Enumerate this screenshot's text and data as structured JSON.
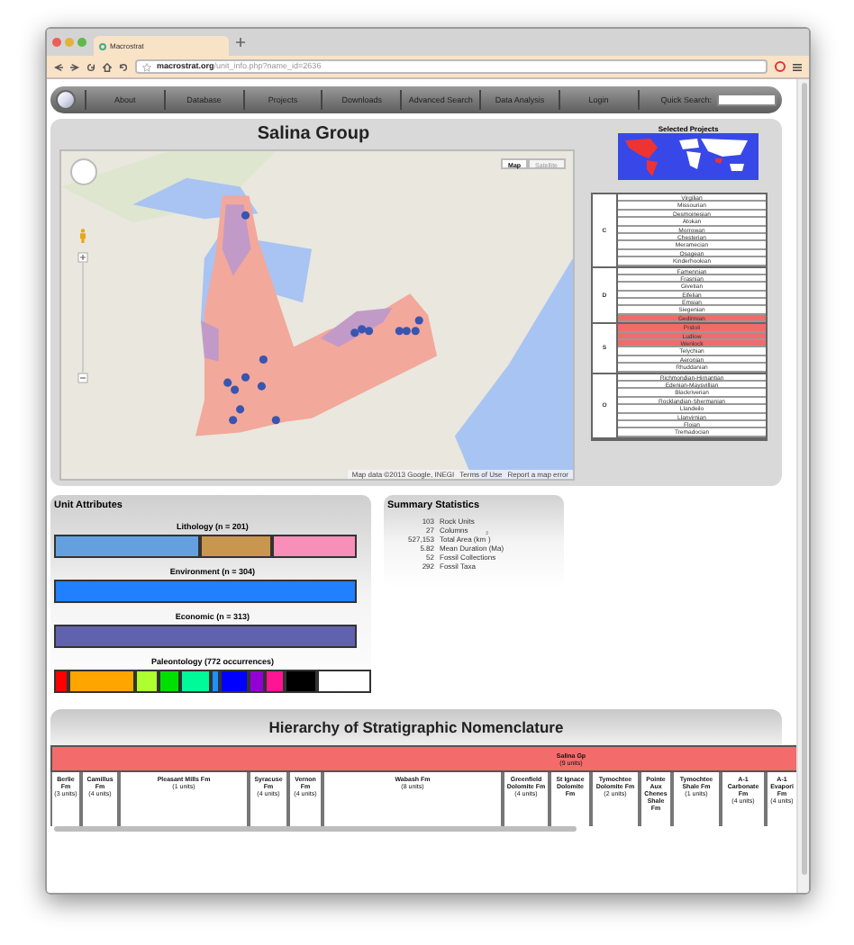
{
  "browser": {
    "tab_title": "Macrostrat",
    "url_host": "macrostrat.org",
    "url_path": "/unit_info.php?name_id=2636"
  },
  "nav": {
    "items": [
      "About",
      "Database",
      "Projects",
      "Downloads",
      "Advanced Search",
      "Data Analysis",
      "Login"
    ],
    "quick_search_label": "Quick Search:"
  },
  "title": "Salina Group",
  "map": {
    "type_buttons": [
      {
        "label": "Map",
        "selected": true
      },
      {
        "label": "Satellite",
        "selected": false
      }
    ],
    "attribution": [
      "Map data ©2013 Google, INEGI",
      "Terms of Use",
      "Report a map error"
    ]
  },
  "selected_projects_label": "Selected Projects",
  "timescale": [
    {
      "period": "C",
      "stages": [
        {
          "name": "Virgilian",
          "selected": false
        },
        {
          "name": "Missourian",
          "selected": false
        },
        {
          "name": "Desmoinesian",
          "selected": false
        },
        {
          "name": "Atokan",
          "selected": false
        },
        {
          "name": "Morrowan",
          "selected": false
        },
        {
          "name": "Chesterian",
          "selected": false
        },
        {
          "name": "Meramecian",
          "selected": false
        },
        {
          "name": "Osagean",
          "selected": false
        },
        {
          "name": "Kinderhookian",
          "selected": false
        }
      ]
    },
    {
      "period": "D",
      "stages": [
        {
          "name": "Famennian",
          "selected": false
        },
        {
          "name": "Frasnian",
          "selected": false
        },
        {
          "name": "Givetian",
          "selected": false
        },
        {
          "name": "Eifelian",
          "selected": false
        },
        {
          "name": "Emsian",
          "selected": false
        },
        {
          "name": "Siegenian",
          "selected": false
        },
        {
          "name": "Gedinnian",
          "selected": true
        }
      ]
    },
    {
      "period": "S",
      "stages": [
        {
          "name": "Pridoli",
          "selected": true
        },
        {
          "name": "Ludlow",
          "selected": true
        },
        {
          "name": "Wenlock",
          "selected": true
        },
        {
          "name": "Telychian",
          "selected": false
        },
        {
          "name": "Aeronian",
          "selected": false
        },
        {
          "name": "Rhuddanian",
          "selected": false
        }
      ]
    },
    {
      "period": "O",
      "stages": [
        {
          "name": "Richmondian-Hirnantian",
          "selected": false
        },
        {
          "name": "Edenian-Maysvillian",
          "selected": false
        },
        {
          "name": "Blackriverian",
          "selected": false
        },
        {
          "name": "Rocklandian-Shermanian",
          "selected": false
        },
        {
          "name": "Llandeilo",
          "selected": false
        },
        {
          "name": "Llanvirnian",
          "selected": false
        },
        {
          "name": "Floian",
          "selected": false
        },
        {
          "name": "Tremadocian",
          "selected": false
        }
      ]
    }
  ],
  "unit_attributes": {
    "title": "Unit Attributes",
    "bars": [
      {
        "label": "Lithology (n = 201)",
        "segments": [
          {
            "color": "#64a0e0"
          },
          {
            "color": "#c8964f"
          },
          {
            "color": "#f78fb8"
          }
        ]
      },
      {
        "label": "Environment (n = 304)",
        "segments": [
          {
            "color": "#2080ff"
          }
        ]
      },
      {
        "label": "Economic (n = 313)",
        "segments": [
          {
            "color": "#6062ad"
          }
        ]
      },
      {
        "label": "Paleontology (772 occurrences)",
        "segments": [
          {
            "color": "#ff0000"
          },
          {
            "color": "#ffa500"
          },
          {
            "color": "#adff2f"
          },
          {
            "color": "#00e000"
          },
          {
            "color": "#00fa9a"
          },
          {
            "color": "#1e90ff"
          },
          {
            "color": "#0000ff"
          },
          {
            "color": "#9400d3"
          },
          {
            "color": "#ff1493"
          },
          {
            "color": "#000000"
          },
          {
            "color": "#ffffff"
          }
        ]
      }
    ]
  },
  "summary": {
    "title": "Summary Statistics",
    "rows": [
      {
        "count": "103",
        "label": "Rock Units"
      },
      {
        "count": "27",
        "label": "Columns"
      },
      {
        "count": "527,153",
        "label": "Total Area (km$^{2}$)"
      },
      {
        "count": "5.82",
        "label": "Mean Duration (Ma)"
      },
      {
        "count": "52",
        "label": "Fossil Collections"
      },
      {
        "count": "292",
        "label": "Fossil Taxa"
      }
    ]
  },
  "hierarchy": {
    "title": "Hierarchy of Stratigraphic Nomenclature",
    "group": {
      "name": "Salina Gp",
      "count": "(9 units)"
    },
    "formations": [
      {
        "name": "Berlie Fm",
        "count": "(3 units)"
      },
      {
        "name": "Camillus Fm",
        "count": "(4 units)"
      },
      {
        "name": "Pleasant Mills Fm",
        "count": "(1 units)"
      },
      {
        "name": "Syracuse Fm",
        "count": "(4 units)"
      },
      {
        "name": "Vernon Fm",
        "count": "(4 units)"
      },
      {
        "name": "Wabash Fm",
        "count": "(8 units)"
      },
      {
        "name": "Greenfield Dolomite Fm",
        "count": "(4 units)"
      },
      {
        "name": "St Ignace Dolomite Fm"
      },
      {
        "name": "Tymochtee Dolomite Fm",
        "count": "(2 units)"
      },
      {
        "name": "Pointe Aux Chenes Shale Fm"
      },
      {
        "name": "Tymochtee Shale Fm",
        "count": "(1 units)"
      },
      {
        "name": "A-1 Carbonate Fm",
        "count": "(4 units)"
      },
      {
        "name": "A-1 Evapori Fm",
        "count": "(4 units)"
      }
    ]
  }
}
